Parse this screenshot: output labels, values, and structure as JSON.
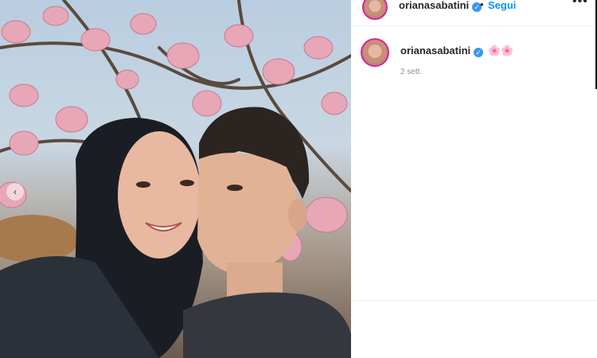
{
  "post": {
    "username": "orianasabatini",
    "follow_label": "Segui",
    "separator": "•",
    "more_label": "•••",
    "caption": "🌸🌸",
    "time_ago": "2 sett."
  },
  "colors": {
    "follow_blue": "#0095f6",
    "verified_blue": "#3897f0",
    "story_ring": "#d6249f"
  },
  "icons": {
    "verified": "verified-badge-icon",
    "more": "more-options-icon",
    "carousel": "carousel-prev-icon"
  }
}
